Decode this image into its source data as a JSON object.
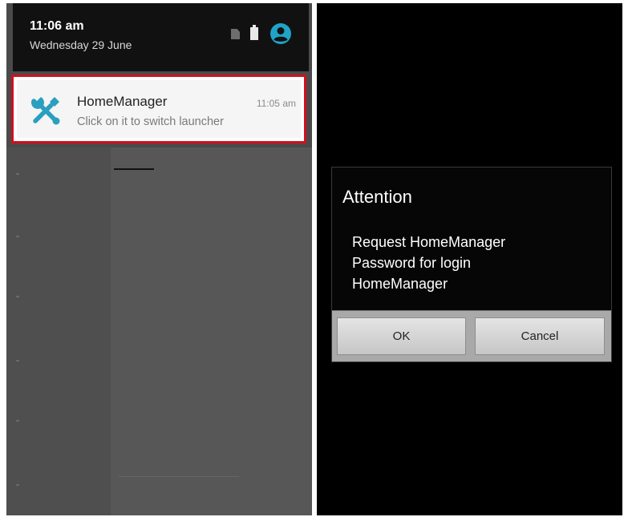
{
  "left_screen": {
    "status_bar": {
      "time": "11:06 am",
      "date": "Wednesday 29 June",
      "icons": [
        "sim-card-icon",
        "battery-icon",
        "account-circle-icon"
      ]
    },
    "notification": {
      "app_name": "HomeManager",
      "time": "11:05 am",
      "text": "Click on it to switch launcher",
      "icon": "wrench-screwdriver-icon",
      "icon_color": "#2a9fbf",
      "highlight_color": "#d01020"
    }
  },
  "right_screen": {
    "dialog": {
      "title": "Attention",
      "message_lines": [
        "Request HomeManager",
        "Password for login",
        "HomeManager"
      ],
      "buttons": {
        "ok": "OK",
        "cancel": "Cancel"
      }
    }
  },
  "colors": {
    "accent": "#1fa3c8",
    "highlight": "#d01020",
    "dialog_background": "#060606",
    "button_bar": "#a9a9a9"
  }
}
